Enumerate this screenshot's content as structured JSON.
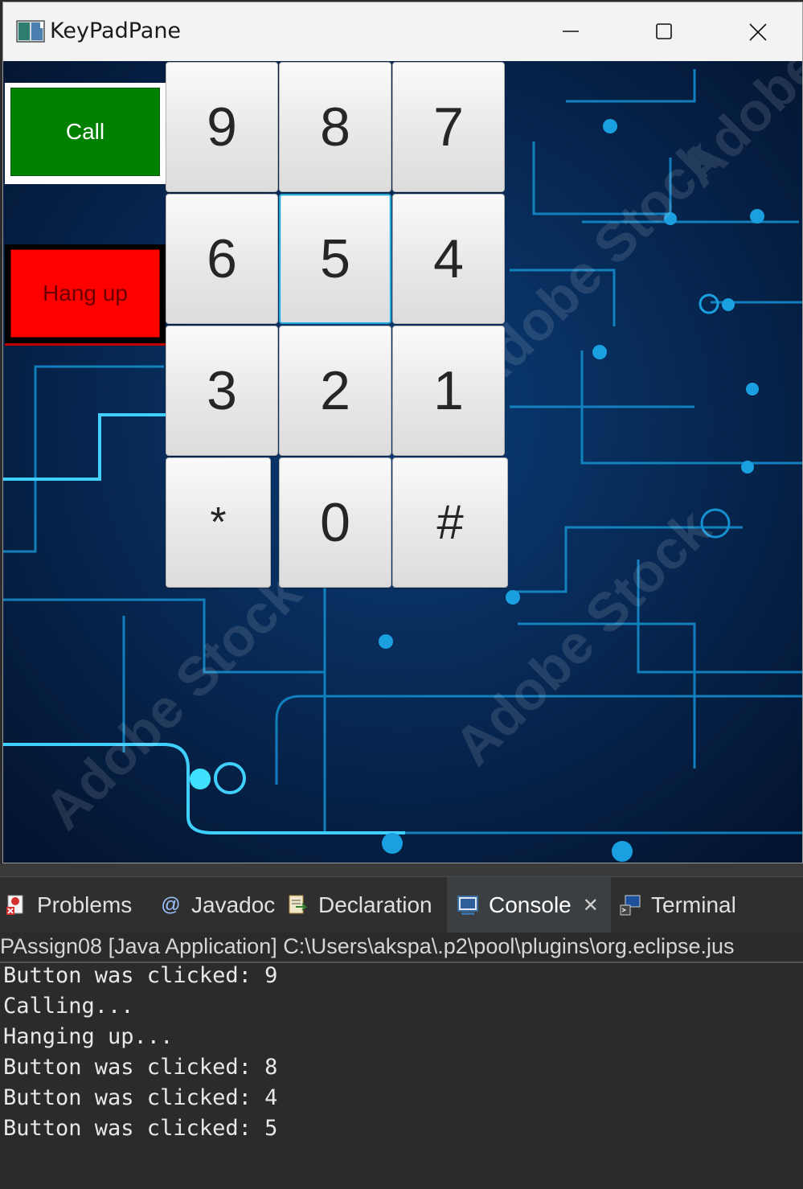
{
  "window": {
    "title": "KeyPadPane",
    "icon": "java-app-icon",
    "controls": [
      "minimize-icon",
      "maximize-icon",
      "close-icon"
    ]
  },
  "buttons": {
    "call": "Call",
    "hangup": "Hang up"
  },
  "keypad": {
    "keys": [
      "9",
      "8",
      "7",
      "6",
      "5",
      "4",
      "3",
      "2",
      "1",
      "*",
      "0",
      "#"
    ],
    "focused_key": "5"
  },
  "colors": {
    "call": "#008000",
    "hangup": "#ff0000",
    "background": "#041a3a",
    "circuit": "#1aa0e0"
  },
  "watermark": "Adobe Stock",
  "eclipse": {
    "tabs": [
      {
        "label": "Problems",
        "icon": "problems-icon"
      },
      {
        "label": "Javadoc",
        "icon": "javadoc-icon"
      },
      {
        "label": "Declaration",
        "icon": "declaration-icon"
      },
      {
        "label": "Console",
        "icon": "console-icon",
        "active": true
      },
      {
        "label": "Terminal",
        "icon": "terminal-icon"
      }
    ],
    "launch_info": "PAssign08 [Java Application] C:\\Users\\akspa\\.p2\\pool\\plugins\\org.eclipse.jus",
    "console_lines": [
      "Button was clicked: 9",
      "Calling...",
      "Hanging up...",
      "Button was clicked: 8",
      "Button was clicked: 4",
      "Button was clicked: 5"
    ]
  }
}
